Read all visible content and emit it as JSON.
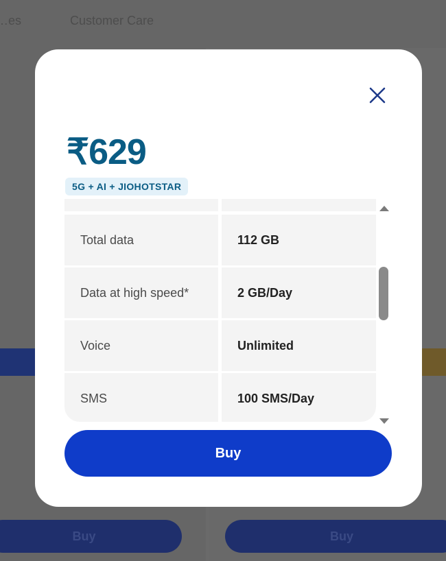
{
  "background": {
    "nav_items": [
      "…es",
      "Customer Care"
    ],
    "buy_left": "Buy",
    "buy_right": "Buy"
  },
  "modal": {
    "price": "₹629",
    "badge": "5G + AI + JIOHOTSTAR",
    "rows": [
      {
        "label": "Total data",
        "value": "112 GB"
      },
      {
        "label": "Data at high speed*",
        "value": "2 GB/Day"
      },
      {
        "label": "Voice",
        "value": "Unlimited"
      },
      {
        "label": "SMS",
        "value": "100 SMS/Day"
      }
    ],
    "buy_label": "Buy",
    "icons": {
      "close": "close-icon",
      "scroll_up": "triangle-up-icon",
      "scroll_down": "triangle-down-icon"
    }
  },
  "colors": {
    "price": "#0a5c84",
    "badge_bg": "#e3f1f9",
    "buy_button": "#0f3cc9",
    "close_icon": "#1e3a8a"
  }
}
